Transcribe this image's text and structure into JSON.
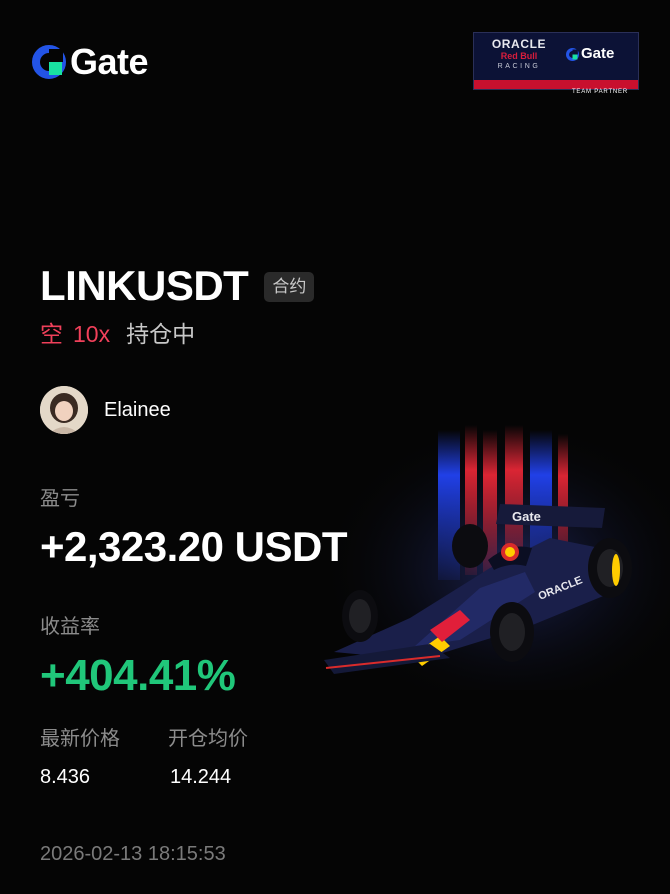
{
  "brand": {
    "name": "Gate",
    "accent": "#2354e6",
    "logo_icon": "gate-logo-icon"
  },
  "partner_badge": {
    "oracle": "ORACLE",
    "redbull": "Red Bull",
    "racing": "RACING",
    "gate": "Gate",
    "team_partner": "TEAM PARTNER"
  },
  "position": {
    "pair": "LINKUSDT",
    "type_tag": "合约",
    "side": "空",
    "leverage": "10x",
    "status": "持仓中"
  },
  "user": {
    "name": "Elainee",
    "avatar_icon": "user-avatar"
  },
  "pnl": {
    "label": "盈亏",
    "value": "+2,323.20 USDT"
  },
  "roi": {
    "label": "收益率",
    "value": "+404.41%",
    "color": "#20c77a"
  },
  "prices": {
    "latest_label": "最新价格",
    "latest_value": "8.436",
    "entry_label": "开仓均价",
    "entry_value": "14.244"
  },
  "timestamp": "2026-02-13 18:15:53",
  "colors": {
    "short": "#f0405a",
    "background": "#050505"
  }
}
